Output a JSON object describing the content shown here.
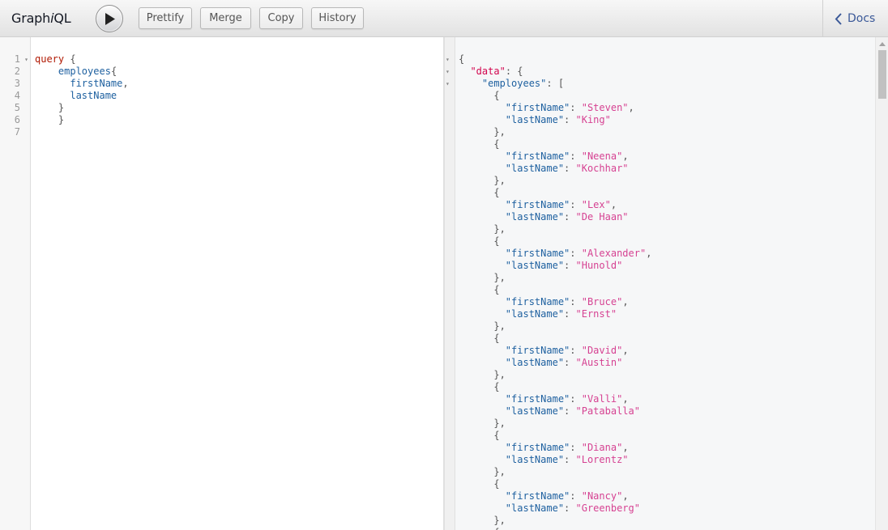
{
  "app": {
    "title_prefix": "Graph",
    "title_italic": "i",
    "title_suffix": "QL"
  },
  "toolbar": {
    "prettify_label": "Prettify",
    "merge_label": "Merge",
    "copy_label": "Copy",
    "history_label": "History",
    "docs_label": "Docs",
    "execute_icon": "play-icon",
    "docs_icon": "chevron-left-icon"
  },
  "query": {
    "line_numbers": [
      "1",
      "2",
      "3",
      "4",
      "5",
      "6",
      "7"
    ],
    "keyword": "query",
    "root_field": "employees",
    "fields": [
      "firstName",
      "lastName"
    ]
  },
  "result": {
    "root_key": "data",
    "list_key": "employees",
    "employees": [
      {
        "firstName": "Steven",
        "lastName": "King"
      },
      {
        "firstName": "Neena",
        "lastName": "Kochhar"
      },
      {
        "firstName": "Lex",
        "lastName": "De Haan"
      },
      {
        "firstName": "Alexander",
        "lastName": "Hunold"
      },
      {
        "firstName": "Bruce",
        "lastName": "Ernst"
      },
      {
        "firstName": "David",
        "lastName": "Austin"
      },
      {
        "firstName": "Valli",
        "lastName": "Pataballa"
      },
      {
        "firstName": "Diana",
        "lastName": "Lorentz"
      },
      {
        "firstName": "Nancy",
        "lastName": "Greenberg"
      }
    ]
  },
  "colors": {
    "keyword": "#b11a04",
    "property": "#1f61a0",
    "string": "#d64292",
    "docs_link": "#3b5998"
  }
}
